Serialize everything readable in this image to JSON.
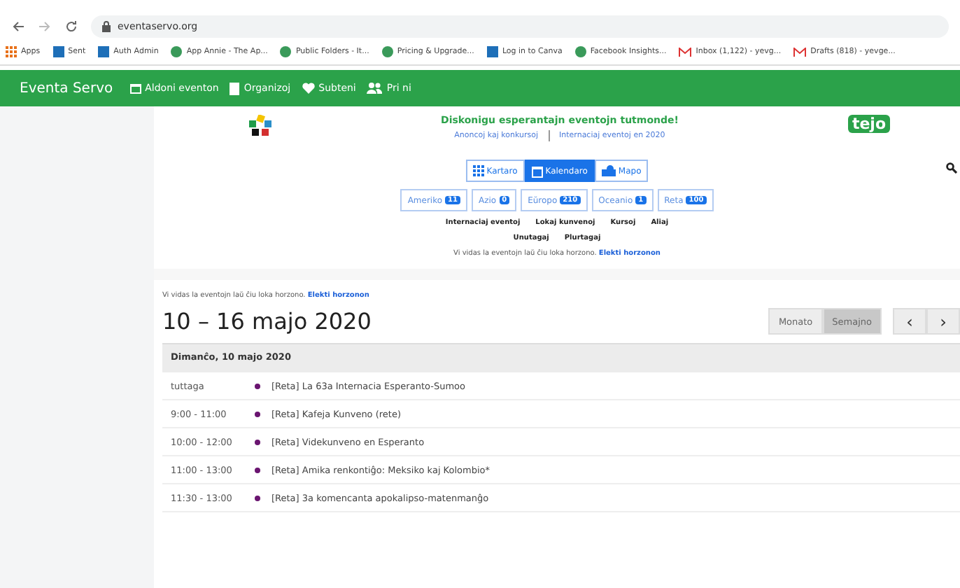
{
  "browser": {
    "url": "eventaservo.org",
    "bookmarks": [
      {
        "label": "Apps",
        "kind": "grid"
      },
      {
        "label": "Sent",
        "kind": "square"
      },
      {
        "label": "Auth Admin",
        "kind": "square"
      },
      {
        "label": "App Annie - The Ap...",
        "kind": "circle"
      },
      {
        "label": "Public Folders - It...",
        "kind": "circle"
      },
      {
        "label": "Pricing & Upgrade...",
        "kind": "circle"
      },
      {
        "label": "Log in to Canva",
        "kind": "square"
      },
      {
        "label": "Facebook Insights...",
        "kind": "circle"
      },
      {
        "label": "Inbox (1,122) - yevg...",
        "kind": "mail"
      },
      {
        "label": "Drafts (818) - yevge...",
        "kind": "mail"
      }
    ]
  },
  "navbar": {
    "brand": "Eventa Servo",
    "items": [
      {
        "label": "Aldoni eventon",
        "kind": "calendar"
      },
      {
        "label": "Organizoj",
        "kind": "book"
      },
      {
        "label": "Subteni",
        "kind": "heart"
      },
      {
        "label": "Pri ni",
        "kind": "users"
      }
    ]
  },
  "header": {
    "tagline": "Diskonigu esperantajn eventojn tutmonde!",
    "links": [
      "Anoncoj kaj konkursoj",
      "Internaciaj eventoj en 2020"
    ],
    "logo_text": "tejo"
  },
  "views": [
    {
      "label": "Kartaro",
      "kind": "grid",
      "selected": false
    },
    {
      "label": "Kalendaro",
      "kind": "calendar",
      "selected": true
    },
    {
      "label": "Mapo",
      "kind": "map",
      "selected": false
    }
  ],
  "regions": [
    {
      "label": "Ameriko",
      "count": "11"
    },
    {
      "label": "Azio",
      "count": "0"
    },
    {
      "label": "Eŭropo",
      "count": "210"
    },
    {
      "label": "Oceanio",
      "count": "1"
    },
    {
      "label": "Reta",
      "count": "100"
    }
  ],
  "filters": [
    [
      "Internaciaj eventoj",
      "Lokaj kunvenoj",
      "Kursoj",
      "Aliaj"
    ],
    [
      "Unutagaj",
      "Plurtagaj"
    ]
  ],
  "horizon_note": {
    "text": "Vi vidas la eventojn laŭ ĉiu loka horzono.",
    "link": "Elekti horzonon"
  },
  "calendar": {
    "horizon_note": {
      "text": "Vi vidas la eventojn laŭ ĉiu loka horzono.",
      "link": "Elekti horzonon"
    },
    "title": "10 – 16 majo 2020",
    "modes": [
      {
        "label": "Monato",
        "selected": false
      },
      {
        "label": "Semajno",
        "selected": true
      }
    ],
    "prev": "‹",
    "next": "›",
    "day": "Dimanĉo, 10 majo 2020",
    "events": [
      {
        "time": "tuttaga",
        "title": "[Reta] La 63a Internacia Esperanto-Sumoo"
      },
      {
        "time": "9:00 - 11:00",
        "title": "[Reta] Kafeja Kunveno (rete)"
      },
      {
        "time": "10:00 - 12:00",
        "title": "[Reta] Videkunveno en Esperanto"
      },
      {
        "time": "11:00 - 13:00",
        "title": "[Reta] Amika renkontiĝo: Meksiko kaj Kolombio*"
      },
      {
        "time": "11:30 - 13:00",
        "title": "[Reta] 3a komencanta apokalipso-matenmanĝo"
      }
    ]
  }
}
